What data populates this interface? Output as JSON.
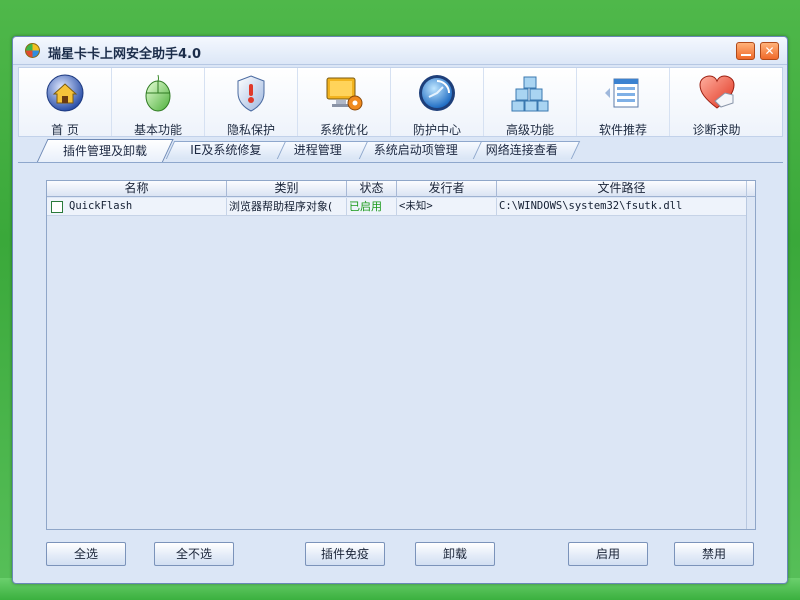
{
  "window": {
    "title": "瑞星卡卡上网安全助手4.0"
  },
  "toolbar": [
    {
      "label": "首 页",
      "icon": "home-icon"
    },
    {
      "label": "基本功能",
      "icon": "mouse-icon"
    },
    {
      "label": "隐私保护",
      "icon": "shield-icon"
    },
    {
      "label": "系统优化",
      "icon": "monitor-gear-icon"
    },
    {
      "label": "防护中心",
      "icon": "globe-icon"
    },
    {
      "label": "高级功能",
      "icon": "cubes-icon"
    },
    {
      "label": "软件推荐",
      "icon": "window-list-icon"
    },
    {
      "label": "诊断求助",
      "icon": "heart-hand-icon"
    }
  ],
  "tabs": [
    {
      "label": "插件管理及卸载",
      "active": true
    },
    {
      "label": "IE及系统修复"
    },
    {
      "label": "进程管理"
    },
    {
      "label": "系统启动项管理"
    },
    {
      "label": "网络连接查看"
    }
  ],
  "list": {
    "columns": [
      "名称",
      "类别",
      "状态",
      "发行者",
      "文件路径"
    ],
    "rows": [
      {
        "checked": false,
        "name": "QuickFlash",
        "category": "浏览器帮助程序对象(",
        "status": "已启用",
        "publisher": "<未知>",
        "path": "C:\\WINDOWS\\system32\\fsutk.dll"
      }
    ]
  },
  "buttons": {
    "select_all": "全选",
    "select_none": "全不选",
    "immune": "插件免疫",
    "uninstall": "卸载",
    "enable": "启用",
    "disable": "禁用"
  },
  "colors": {
    "desktop": "#3aa83a",
    "window_bg": "#dbe6f6",
    "status_enabled": "#1a9a1a",
    "close_button": "#f06a2a"
  }
}
